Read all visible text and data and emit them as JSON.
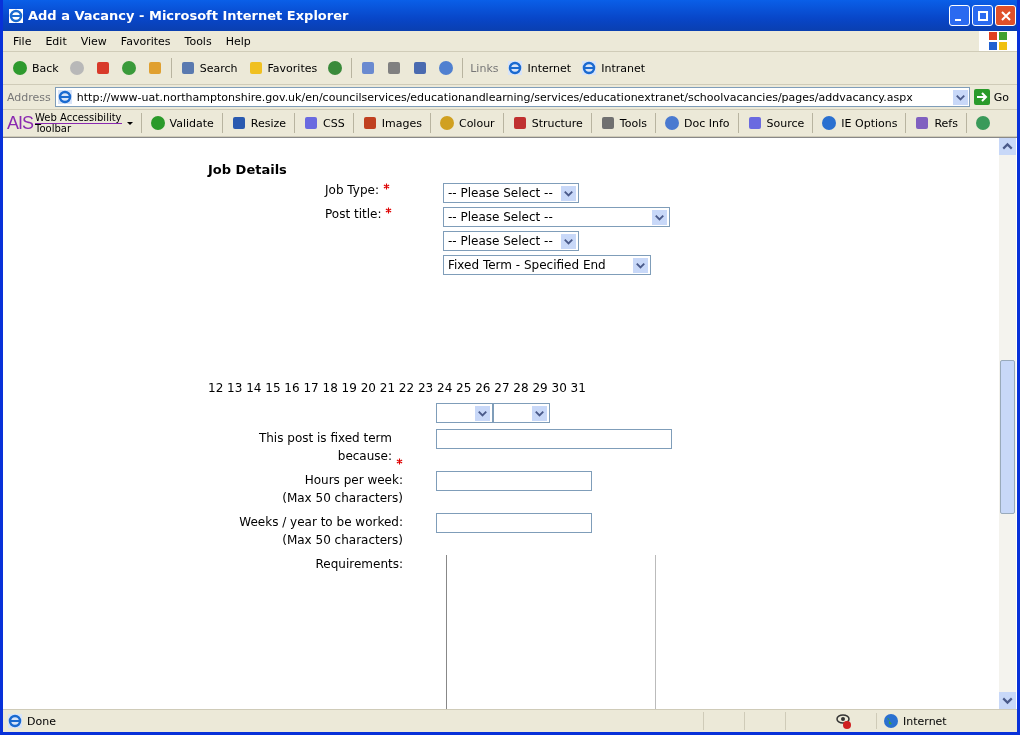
{
  "window": {
    "title": "Add a Vacancy - Microsoft Internet Explorer"
  },
  "menu": [
    "File",
    "Edit",
    "View",
    "Favorites",
    "Tools",
    "Help"
  ],
  "toolbar": [
    {
      "kind": "back",
      "label": "Back"
    },
    {
      "kind": "forward"
    },
    {
      "kind": "stop"
    },
    {
      "kind": "refresh"
    },
    {
      "kind": "home"
    },
    {
      "kind": "search",
      "label": "Search"
    },
    {
      "kind": "favorites",
      "label": "Favorites"
    },
    {
      "kind": "history"
    },
    {
      "kind": "mail"
    },
    {
      "kind": "print"
    },
    {
      "kind": "edit"
    },
    {
      "kind": "messenger"
    }
  ],
  "links": {
    "label": "Links",
    "items": [
      "Internet",
      "Intranet"
    ]
  },
  "address": {
    "label": "Address",
    "url": "http://www-uat.northamptonshire.gov.uk/en/councilservices/educationandlearning/services/educationextranet/schoolvacancies/pages/addvacancy.aspx",
    "go": "Go"
  },
  "ais_toolbar": {
    "logo": "AIS",
    "name_top": "Web Accessibility",
    "name_bottom": "Toolbar",
    "items": [
      {
        "kind": "check",
        "label": "Validate"
      },
      {
        "kind": "window",
        "label": "Resize"
      },
      {
        "kind": "doc",
        "label": "CSS"
      },
      {
        "kind": "picture",
        "label": "Images"
      },
      {
        "kind": "palette",
        "label": "Colour"
      },
      {
        "kind": "grid",
        "label": "Structure"
      },
      {
        "kind": "gear",
        "label": "Tools"
      },
      {
        "kind": "info",
        "label": "Doc Info"
      },
      {
        "kind": "doc",
        "label": "Source"
      },
      {
        "kind": "globe",
        "label": "IE Options"
      },
      {
        "kind": "pen",
        "label": "Refs"
      },
      {
        "kind": "magnifier"
      }
    ]
  },
  "form": {
    "heading": "Job Details",
    "selects": [
      {
        "label": "Job Type:",
        "required": true,
        "value": "-- Please Select --"
      },
      {
        "label": "Post title:",
        "required": true,
        "value": "-- Please Select --"
      },
      {
        "required": false,
        "value": "-- Please Select --"
      },
      {
        "required": false,
        "value": "Fixed Term - Specified End"
      }
    ],
    "days": "12 13 14 15 16 17 18 19 20 21 22 23 24 25 26 27 28 29 30 31",
    "fields": [
      {
        "label": "This post is fixed term because:",
        "required": true
      },
      {
        "label": "Hours per week:",
        "note": "(Max 50 characters)",
        "required": false
      },
      {
        "label": "Weeks / year to be worked:",
        "note": "(Max 50 characters)",
        "required": false
      }
    ],
    "requirements_label": "Requirements:"
  },
  "status_bar": {
    "text": "Done",
    "zone": "Internet"
  }
}
